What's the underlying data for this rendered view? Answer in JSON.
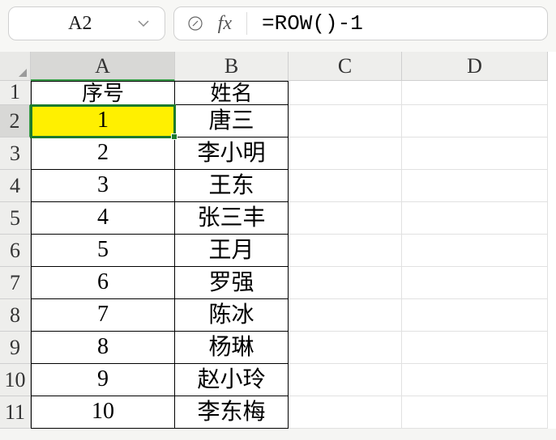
{
  "name_box": {
    "value": "A2"
  },
  "formula": {
    "fx_label": "fx",
    "value": "=ROW()-1"
  },
  "columns": [
    "A",
    "B",
    "C",
    "D"
  ],
  "rows": [
    "1",
    "2",
    "3",
    "4",
    "5",
    "6",
    "7",
    "8",
    "9",
    "10",
    "11"
  ],
  "selected_cell": "A2",
  "table": {
    "header": {
      "a": "序号",
      "b": "姓名"
    },
    "data": [
      {
        "a": "1",
        "b": "唐三"
      },
      {
        "a": "2",
        "b": "李小明"
      },
      {
        "a": "3",
        "b": "王东"
      },
      {
        "a": "4",
        "b": "张三丰"
      },
      {
        "a": "5",
        "b": "王月"
      },
      {
        "a": "6",
        "b": "罗强"
      },
      {
        "a": "7",
        "b": "陈冰"
      },
      {
        "a": "8",
        "b": "杨琳"
      },
      {
        "a": "9",
        "b": "赵小玲"
      },
      {
        "a": "10",
        "b": "李东梅"
      }
    ]
  }
}
